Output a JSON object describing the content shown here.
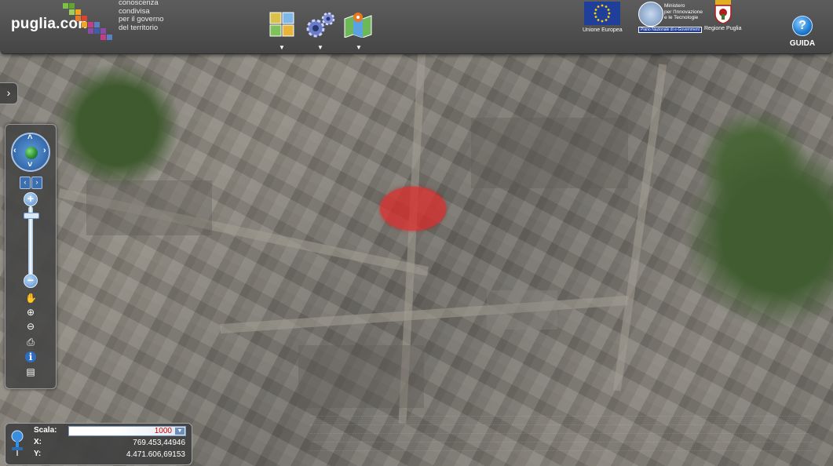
{
  "header": {
    "logo_text": "puglia.con",
    "tagline": [
      "conoscenza",
      "condivisa",
      "per il governo",
      "del territorio"
    ],
    "tools": [
      {
        "icon": "layers-grid-icon"
      },
      {
        "icon": "gears-icon"
      },
      {
        "icon": "map-pin-icon"
      }
    ],
    "partners": [
      {
        "icon": "eu-flag-icon",
        "label": "Unione Europea"
      },
      {
        "icon": "ministry-seal-icon",
        "lines": [
          "Ministero",
          "per l'Innovazione",
          "e le Tecnologie"
        ],
        "sublabel": "Piano Nazionale di e-Government"
      },
      {
        "icon": "regione-crest-icon",
        "label": "Regione Puglia"
      }
    ],
    "help": {
      "icon": "help-icon",
      "symbol": "?",
      "label": "GUIDA"
    }
  },
  "sidebar": {
    "toggle_icon": "chevron-right-icon",
    "toggle_symbol": "›"
  },
  "nav": {
    "compass_icon": "compass-globe-icon",
    "zoom_in_symbol": "+",
    "zoom_out_symbol": "−",
    "zoom_level": 0.12,
    "tools": [
      {
        "icon": "hand-pan-icon",
        "symbol": "✋"
      },
      {
        "icon": "zoom-in-small-icon",
        "symbol": "⊕"
      },
      {
        "icon": "zoom-out-small-icon",
        "symbol": "⊖"
      },
      {
        "icon": "print-icon",
        "symbol": "⎙"
      },
      {
        "icon": "info-icon",
        "symbol": "i"
      },
      {
        "icon": "legend-icon",
        "symbol": "▤"
      }
    ]
  },
  "scale_panel": {
    "scale_label": "Scala:",
    "scale_value": "1000",
    "x_label": "X:",
    "x_value": "769.453,44946",
    "y_label": "Y:",
    "y_value": "4.471.606,69153"
  },
  "colors": {
    "marker": "#e12828",
    "panel_bg": "#464646",
    "accent_blue": "#3d74b6"
  }
}
